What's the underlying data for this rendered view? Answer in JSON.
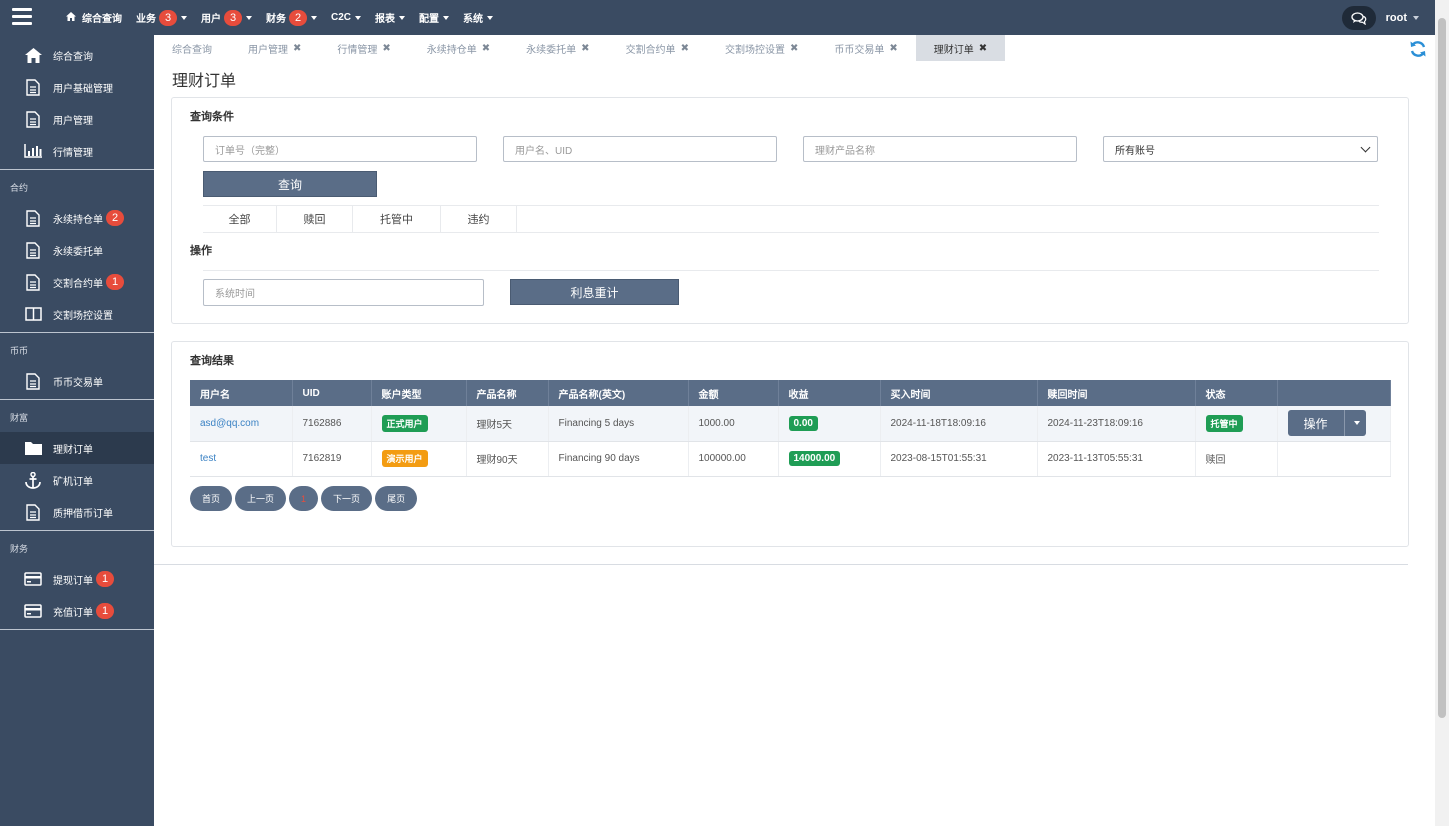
{
  "topnav": {
    "items": [
      {
        "label": "综合查询"
      },
      {
        "label": "业务",
        "badge": "3"
      },
      {
        "label": "用户",
        "badge": "3"
      },
      {
        "label": "财务",
        "badge": "2"
      },
      {
        "label": "C2C"
      },
      {
        "label": "报表"
      },
      {
        "label": "配置"
      },
      {
        "label": "系统"
      }
    ],
    "user": "root"
  },
  "sidebar": {
    "top": [
      {
        "label": "综合查询",
        "icon": "home-icon"
      },
      {
        "label": "用户基础管理",
        "icon": "file-icon"
      },
      {
        "label": "用户管理",
        "icon": "file-icon"
      },
      {
        "label": "行情管理",
        "icon": "bar-chart-icon"
      }
    ],
    "group_contract": "合约",
    "contract": [
      {
        "label": "永续持仓单",
        "badge": "2"
      },
      {
        "label": "永续委托单"
      },
      {
        "label": "交割合约单",
        "badge": "1"
      },
      {
        "label": "交割场控设置"
      }
    ],
    "group_coin": "币币",
    "coin": [
      {
        "label": "币币交易单"
      }
    ],
    "group_wealth": "财富",
    "wealth": [
      {
        "label": "理财订单"
      },
      {
        "label": "矿机订单"
      },
      {
        "label": "质押借币订单"
      }
    ],
    "group_finance": "财务",
    "finance": [
      {
        "label": "提现订单",
        "badge": "1"
      },
      {
        "label": "充值订单",
        "badge": "1"
      }
    ]
  },
  "tabs": [
    {
      "label": "综合查询",
      "closable": false
    },
    {
      "label": "用户管理",
      "closable": true
    },
    {
      "label": "行情管理",
      "closable": true
    },
    {
      "label": "永续持仓单",
      "closable": true
    },
    {
      "label": "永续委托单",
      "closable": true
    },
    {
      "label": "交割合约单",
      "closable": true
    },
    {
      "label": "交割场控设置",
      "closable": true
    },
    {
      "label": "币币交易单",
      "closable": true
    },
    {
      "label": "理财订单",
      "closable": true,
      "active": true
    }
  ],
  "page": {
    "title": "理财订单"
  },
  "query": {
    "heading": "查询条件",
    "order_placeholder": "订单号（完整）",
    "user_placeholder": "用户名、UID",
    "product_placeholder": "理财产品名称",
    "account_select": "所有账号",
    "search_label": "查询",
    "filter_tabs": [
      "全部",
      "赎回",
      "托管中",
      "违约"
    ],
    "ops_heading": "操作",
    "time_placeholder": "系统时间",
    "interest_label": "利息重计"
  },
  "results": {
    "heading": "查询结果",
    "columns": [
      "用户名",
      "UID",
      "账户类型",
      "产品名称",
      "产品名称(英文)",
      "金额",
      "收益",
      "买入时间",
      "赎回时间",
      "状态",
      ""
    ],
    "rows": [
      {
        "username": "asd@qq.com",
        "uid": "7162886",
        "account_type": "正式用户",
        "product": "理财5天",
        "product_en": "Financing 5 days",
        "amount": "1000.00",
        "profit": "0.00",
        "buy_time": "2024-11-18T18:09:16",
        "redeem_time": "2024-11-23T18:09:16",
        "status": "托管中",
        "action": "操作"
      },
      {
        "username": "test",
        "uid": "7162819",
        "account_type": "演示用户",
        "product": "理财90天",
        "product_en": "Financing 90 days",
        "amount": "100000.00",
        "profit": "14000.00",
        "buy_time": "2023-08-15T01:55:31",
        "redeem_time": "2023-11-13T05:55:31",
        "status": "赎回",
        "action": ""
      }
    ],
    "pager": {
      "first": "首页",
      "prev": "上一页",
      "current": "1",
      "next": "下一页",
      "last": "尾页"
    }
  },
  "colors": {
    "nav_bg": "#3a4b62",
    "accent": "#5a6d87",
    "badge": "#e74c3c",
    "green": "#1f9d55",
    "orange": "#f39c12"
  }
}
